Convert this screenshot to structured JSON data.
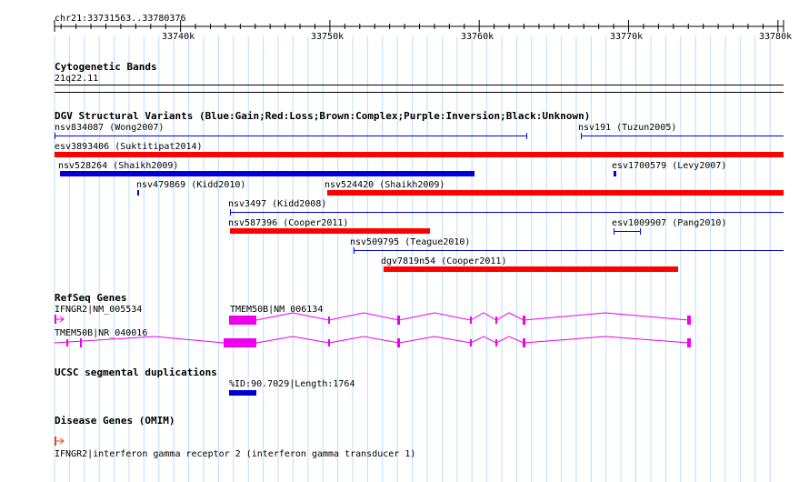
{
  "header": {
    "location": "chr21:33731563..33780376",
    "ticks": [
      "33740k",
      "33750k",
      "33760k",
      "33770k",
      "33780k"
    ]
  },
  "cytogenetic": {
    "title": "Cytogenetic Bands",
    "band": "21q22.11"
  },
  "dgv": {
    "title": "DGV Structural Variants (Blue:Gain;Red:Loss;Brown:Complex;Purple:Inversion;Black:Unknown)",
    "colors": {
      "gain": "#0000dd",
      "loss": "#ff0000",
      "line": "#0000dd"
    },
    "variants": [
      {
        "label": "nsv834087 (Wong2007)",
        "start": 33731563,
        "end": 33763200,
        "type": "line"
      },
      {
        "label": "nsv191 (Tuzun2005)",
        "start": 33766800,
        "end": 33780376,
        "type": "line"
      },
      {
        "label": "esv3893406 (Suktitipat2014)",
        "start": 33731563,
        "end": 33780376,
        "type": "loss"
      },
      {
        "label": "nsv528264 (Shaikh2009)",
        "start": 33731900,
        "end": 33759700,
        "type": "gain"
      },
      {
        "label": "esv1700579 (Levy2007)",
        "start": 33769000,
        "end": 33769150,
        "type": "gain"
      },
      {
        "label": "nsv479869 (Kidd2010)",
        "start": 33737100,
        "end": 33737250,
        "type": "gain"
      },
      {
        "label": "nsv524420 (Shaikh2009)",
        "start": 33749800,
        "end": 33780376,
        "type": "loss"
      },
      {
        "label": "nsv3497 (Kidd2008)",
        "start": 33743300,
        "end": 33780376,
        "type": "line"
      },
      {
        "label": "nsv587396 (Cooper2011)",
        "start": 33743300,
        "end": 33756700,
        "type": "loss"
      },
      {
        "label": "esv1009907 (Pang2010)",
        "start": 33769000,
        "end": 33770800,
        "type": "line"
      },
      {
        "label": "nsv509795 (Teague2010)",
        "start": 33751600,
        "end": 33780376,
        "type": "line"
      },
      {
        "label": "dgv7819n54 (Cooper2011)",
        "start": 33753600,
        "end": 33773300,
        "type": "loss"
      }
    ]
  },
  "refseq": {
    "title": "RefSeq Genes",
    "color": "#ee00ee",
    "genes": [
      {
        "label": "IFNGR2|NM_005534",
        "strand_icon": "right-arrow-icon"
      },
      {
        "label": "TMEM50B|NM_006134"
      },
      {
        "label": "TMEM50B|NR_040016"
      }
    ]
  },
  "segdups": {
    "title": "UCSC segmental duplications",
    "label": "%ID:90.7029|Length:1764",
    "color": "#0000cc"
  },
  "omim": {
    "title": "Disease Genes (OMIM)",
    "label": "IFNGR2|interferon gamma receptor 2 (interferon gamma transducer 1)",
    "color": "#ee4422",
    "strand_icon": "right-arrow-icon"
  }
}
